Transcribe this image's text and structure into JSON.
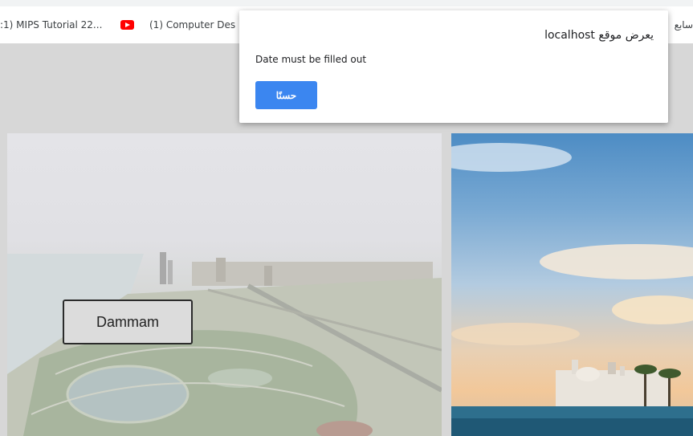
{
  "bookmarks": {
    "items": [
      {
        "label": ":1) MIPS Tutorial 22..."
      },
      {
        "label": "(1) Computer Des",
        "icon": "youtube-icon"
      },
      {
        "label": "سابع"
      }
    ]
  },
  "dialog": {
    "title": "يعرض موقع localhost",
    "message": "Date must be filled out",
    "ok_label": "حسنًا"
  },
  "cards": {
    "left_button_label": "Dammam"
  },
  "colors": {
    "accent": "#3b86f0",
    "youtube": "#ff0000"
  }
}
